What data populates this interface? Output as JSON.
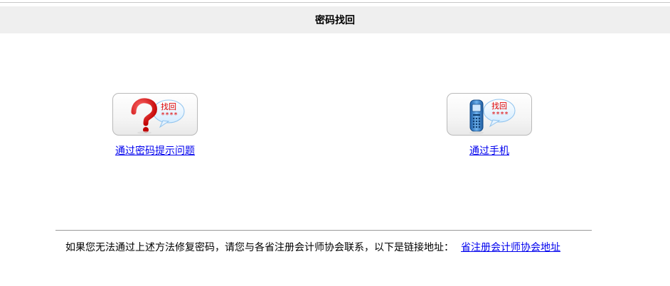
{
  "header": {
    "title": "密码找回"
  },
  "options": [
    {
      "badge_line1": "找回",
      "badge_line2": "****",
      "link_label": "通过密码提示问题"
    },
    {
      "badge_line1": "找回",
      "badge_line2": "****",
      "link_label": "通过手机"
    }
  ],
  "footer": {
    "text": "如果您无法通过上述方法修复密码，请您与各省注册会计师协会联系，以下是链接地址：",
    "link_label": "省注册会计师协会地址"
  },
  "colors": {
    "link": "#0000ee",
    "badge_text": "#e00000",
    "header_bg": "#efefef"
  },
  "icons": [
    "question-mark-icon",
    "mobile-phone-icon"
  ]
}
